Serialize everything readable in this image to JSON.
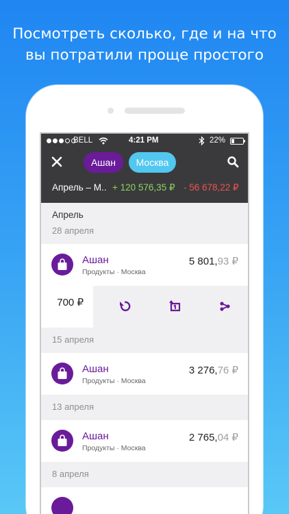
{
  "headline": {
    "line1": "Посмотреть сколько, где и на что",
    "line2": "вы потратили проще простого"
  },
  "status_bar": {
    "carrier": "BELL",
    "time": "4:21 PM",
    "battery": "22%",
    "battery_level": 0.22,
    "signal_bars": 3,
    "signal_total": 5
  },
  "filters": {
    "store_chip": "Ашан",
    "city_chip": "Москва"
  },
  "summary": {
    "period": "Апрель – М..",
    "income": "+ 120 576,35 ₽",
    "expense": "- 56 678,22 ₽"
  },
  "month": "Апрель",
  "groups": [
    {
      "date": "28 апреля",
      "transaction": {
        "title": "Ашан",
        "category": "Продукты",
        "separator": "·",
        "city": "Москва",
        "amount_main": "5 801,",
        "amount_cents": "93 ₽"
      }
    },
    {
      "date": "15 апреля",
      "transaction": {
        "title": "Ашан",
        "category": "Продукты",
        "separator": "·",
        "city": "Москва",
        "amount_main": "3 276,",
        "amount_cents": "76 ₽"
      }
    },
    {
      "date": "13 апреля",
      "transaction": {
        "title": "Ашан",
        "category": "Продукты",
        "separator": "·",
        "city": "Москва",
        "amount_main": "2 765,",
        "amount_cents": "04 ₽"
      }
    },
    {
      "date": "8 апреля"
    }
  ],
  "swipe_actions": {
    "amount": "700 ₽",
    "icons": [
      "undo-icon",
      "repeat-icon",
      "share-icon"
    ]
  },
  "colors": {
    "brand_purple": "#6a1b9a",
    "chip_blue": "#52c7ef",
    "income_green": "#8fd45f",
    "expense_red": "#ef5350",
    "topbar_dark": "#3a3a3c",
    "background_gradient_top": "#1f86f2",
    "background_gradient_bottom": "#59c8f6"
  }
}
